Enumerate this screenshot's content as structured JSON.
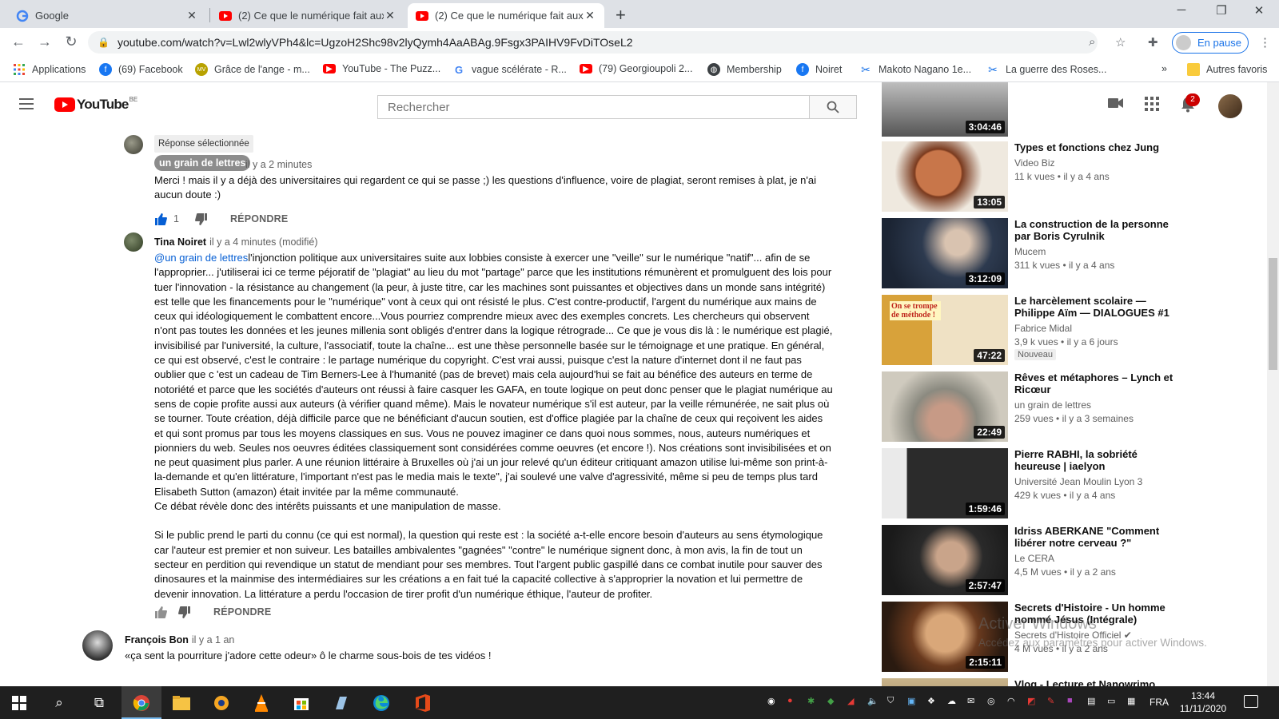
{
  "browser": {
    "tabs": [
      {
        "title": "Google",
        "favicon": "google-icon"
      },
      {
        "title": "(2) Ce que le numérique fait aux l",
        "favicon": "youtube-icon"
      },
      {
        "title": "(2) Ce que le numérique fait aux l",
        "favicon": "youtube-icon"
      }
    ],
    "url": "youtube.com/watch?v=Lwl2wlyVPh4&lc=UgzoH2Shc98v2lyQymh4AaABAg.9Fsgx3PAIHV9FvDiTOseL2",
    "profile_label": "En pause",
    "bookmarks": [
      {
        "label": "Applications",
        "icon": "apps-grid-icon"
      },
      {
        "label": "(69) Facebook",
        "icon": "facebook-icon"
      },
      {
        "label": "Grâce de l'ange - m...",
        "icon": "mv-icon"
      },
      {
        "label": "YouTube - The Puzz...",
        "icon": "youtube-icon"
      },
      {
        "label": "vague scélérate - R...",
        "icon": "google-icon"
      },
      {
        "label": "(79) Georgioupoli 2...",
        "icon": "youtube-icon"
      },
      {
        "label": "Membership",
        "icon": "globe-icon"
      },
      {
        "label": "Noiret",
        "icon": "facebook-icon"
      },
      {
        "label": "Makoto Nagano 1e...",
        "icon": "scissors-icon"
      },
      {
        "label": "La guerre des Roses...",
        "icon": "scissors-icon"
      }
    ],
    "more_bookmarks": "»",
    "other_bookmarks": "Autres favoris"
  },
  "youtube": {
    "logo_text": "YouTube",
    "country_code": "BE",
    "search_placeholder": "Rechercher",
    "notification_count": "2"
  },
  "comments": {
    "selected_reply_label": "Réponse sélectionnée",
    "reply1": {
      "author": "un grain de lettres",
      "time": "il y a 2 minutes",
      "text": "Merci ! mais il y a déjà des universitaires qui regardent ce qui se passe ;) les questions d'influence, voire de plagiat, seront remises à plat, je n'ai aucun doute :)",
      "likes": "1",
      "reply_label": "RÉPONDRE"
    },
    "reply2": {
      "author": "Tina Noiret",
      "time": "il y a 4 minutes (modifié)",
      "mention": "@un grain de lettres",
      "paragraph1": "l'injonction politique aux universitaires suite aux lobbies consiste à exercer une \"veille\" sur le numérique \"natif\"... afin de se l'approprier... j'utiliserai ici ce terme péjoratif de \"plagiat\" au lieu du mot \"partage\" parce que les institutions rémunèrent et promulguent des lois pour tuer l'innovation - la résistance au changement  (la peur, à juste titre, car les machines sont puissantes et objectives dans un monde sans intégrité) est telle que les financements pour le \"numérique\" vont à ceux qui ont résisté le plus. C'est contre-productif, l'argent du numérique aux mains  de ceux qui idéologiquement le combattent encore...Vous pourriez comprendre mieux avec des exemples concrets. Les  chercheurs qui observent n'ont pas toutes les données et les jeunes millenia sont obligés d'entrer dans la logique rétrograde... Ce que je vous dis là : le numérique est plagié,  invisibilisé par l'université, la culture, l'associatif, toute la chaîne... est une thèse personnelle basée sur le témoignage et une pratique. En général, ce qui est observé, c'est le contraire : le partage numérique du copyright. C'est vrai aussi, puisque c'est  la nature d'internet  dont il ne faut pas oublier que c 'est un cadeau de Tim Berners-Lee à l'humanité (pas de brevet) mais cela aujourd'hui se fait au bénéfice des auteurs en terme de notoriété et parce que les sociétés d'auteurs ont réussi à faire casquer les GAFA, en toute logique on peut donc penser que le plagiat numérique au sens de copie profite aussi aux  auteurs (à vérifier quand même). Mais le  novateur numérique s'il est auteur, par la veille rémunérée, ne sait plus où se tourner. Toute création, déjà difficile parce que ne bénéficiant d'aucun soutien, est d'office plagiée par la chaîne de ceux qui reçoivent les aides et qui sont promus par tous les moyens classiques en sus. Vous ne pouvez imaginer ce dans quoi nous sommes, nous, auteurs numériques et pionniers du web.  Seules nos oeuvres éditées classiquement sont considérées comme oeuvres  (et encore !). Nos créations sont invisibilisées et on ne peut quasiment plus parler. A une réunion littéraire à Bruxelles où j'ai un jour relevé qu'un éditeur critiquant amazon utilise lui-même son print-à-la-demande et qu'en littérature, l'important n'est pas le media mais le texte\",  j'ai soulevé une valve d'agressivité, même si peu de temps plus tard Elisabeth Sutton (amazon) était invitée par la même communauté.",
      "paragraph2": "Ce débat révèle donc des intérêts  puissants et une manipulation de masse.",
      "paragraph3": "Si le public prend le parti du connu (ce qui est normal), la question qui reste est : la société  a-t-elle encore besoin d'auteurs au sens étymologique car l'auteur est premier et non suiveur. Les batailles ambivalentes \"gagnées\" \"contre\" le numérique signent donc, à mon avis, la fin de tout un secteur en perdition qui revendique un statut de mendiant pour ses membres. Tout l'argent public gaspillé dans ce combat inutile pour sauver des dinosaures et la mainmise des intermédiaires sur les créations a en fait tué la capacité collective à s'approprier la novation et lui permettre de devenir innovation.  La littérature a  perdu l'occasion de tirer profit d'un numérique éthique, l'auteur  de profiter.",
      "reply_label": "RÉPONDRE"
    },
    "comment3": {
      "author": "François Bon",
      "time": "il y a 1 an",
      "text": "«ça sent la pourriture j'adore cette odeur» ô le charme sous-bois de tes vidéos !"
    }
  },
  "sidebar": {
    "videos": [
      {
        "title": "Types et fonctions chez Jung",
        "channel": "Video Biz",
        "meta": "11 k vues • il y a 4 ans",
        "duration": "13:05"
      },
      {
        "title": "La construction de la personne par Boris Cyrulnik",
        "channel": "Mucem",
        "meta": "311 k vues • il y a 4 ans",
        "duration": "3:12:09"
      },
      {
        "title": "Le harcèlement scolaire — Philippe Aïm — DIALOGUES #1",
        "channel": "Fabrice Midal",
        "meta": "3,9 k vues • il y a 6 jours",
        "duration": "47:22",
        "badge": "Nouveau",
        "thumb_text": "On se trompe de méthode !"
      },
      {
        "title": "Rêves et métaphores – Lynch et Ricœur",
        "channel": "un grain de lettres",
        "meta": "259 vues • il y a 3 semaines",
        "duration": "22:49"
      },
      {
        "title": "Pierre RABHI, la sobriété heureuse | iaelyon",
        "channel": "Université Jean Moulin Lyon 3",
        "meta": "429 k vues • il y a 4 ans",
        "duration": "1:59:46"
      },
      {
        "title": "Idriss ABERKANE \"Comment libérer notre cerveau ?\"",
        "channel": "Le CERA",
        "meta": "4,5 M vues • il y a 2 ans",
        "duration": "2:57:47"
      },
      {
        "title": "Secrets d'Histoire - Un homme nommé Jésus (Intégrale)",
        "channel": "Secrets d'Histoire Officiel",
        "meta": "4 M vues • il y a 2 ans",
        "duration": "2:15:11"
      },
      {
        "title": "Vlog - Lecture et Nanowrimo",
        "channel": "",
        "meta": "",
        "duration": ""
      }
    ],
    "top_duration": "3:04:46"
  },
  "watermark": {
    "line1": "Activer Windows",
    "line2": "Accédez aux paramètres pour activer Windows."
  },
  "taskbar": {
    "lang": "FRA",
    "time": "13:44",
    "date": "11/11/2020"
  },
  "colors": {
    "youtube_red": "#ff0000",
    "link_blue": "#065fd4",
    "like_blue": "#065fd4"
  }
}
